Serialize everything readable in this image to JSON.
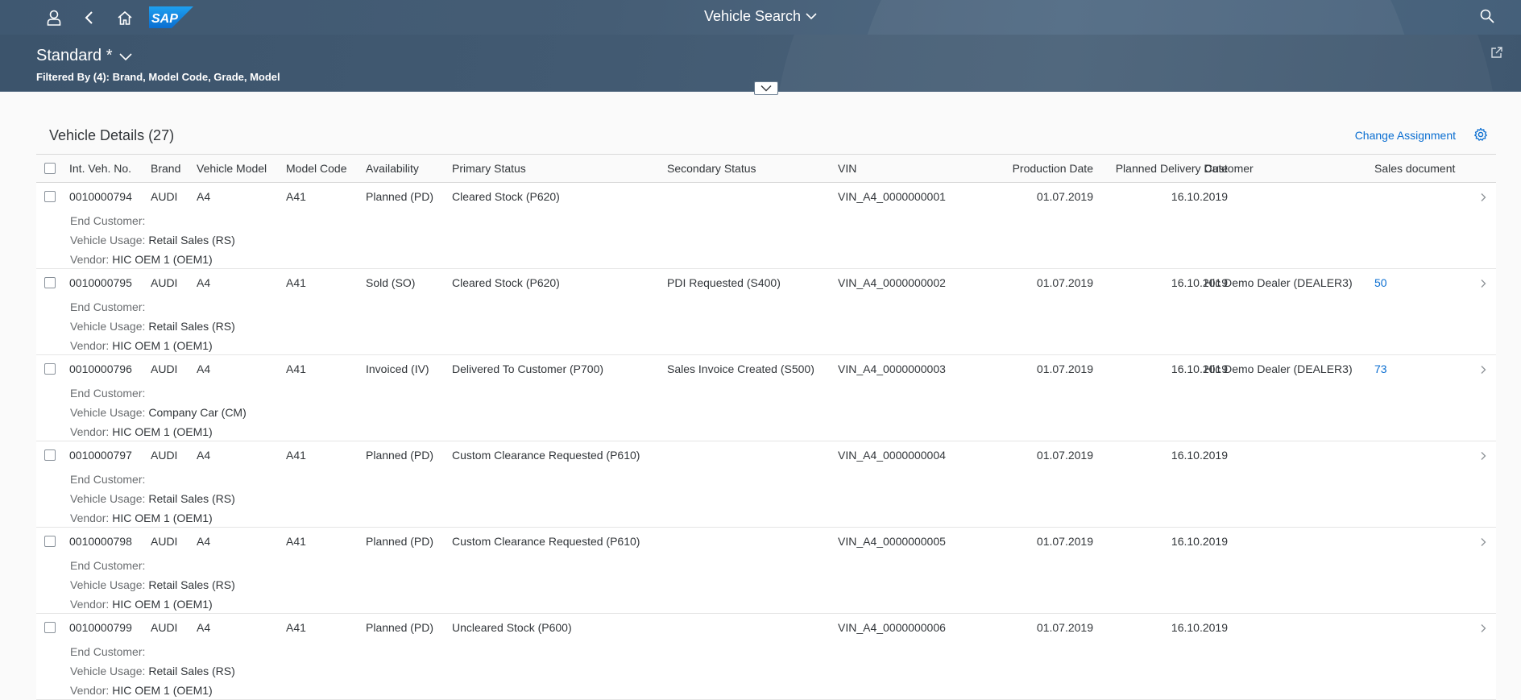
{
  "shell": {
    "title": "Vehicle Search",
    "icons": [
      "user-icon",
      "back-icon",
      "home-icon",
      "sap-logo",
      "search-icon"
    ]
  },
  "header": {
    "variant": "Standard *",
    "filtered_by": "Filtered By (4): Brand, Model Code, Grade, Model"
  },
  "table": {
    "title": "Vehicle Details (27)",
    "change_assignment": "Change Assignment",
    "columns": {
      "int_veh_no": "Int. Veh. No.",
      "brand": "Brand",
      "vehicle_model": "Vehicle Model",
      "model_code": "Model Code",
      "availability": "Availability",
      "primary_status": "Primary Status",
      "secondary_status": "Secondary Status",
      "vin": "VIN",
      "production_date": "Production Date",
      "planned_delivery_date": "Planned Delivery Date",
      "customer": "Customer",
      "sales_document": "Sales document"
    },
    "detail_labels": {
      "end_customer": "End Customer:",
      "vehicle_usage": "Vehicle Usage:",
      "vendor": "Vendor:"
    },
    "rows": [
      {
        "int_veh_no": "0010000794",
        "brand": "AUDI",
        "vehicle_model": "A4",
        "model_code": "A41",
        "availability": "Planned (PD)",
        "primary_status": "Cleared Stock (P620)",
        "secondary_status": "",
        "vin": "VIN_A4_0000000001",
        "production_date": "01.07.2019",
        "planned_delivery_date": "16.10.2019",
        "customer": "",
        "sales_document": "",
        "end_customer": "",
        "vehicle_usage": "Retail Sales (RS)",
        "vendor": "HIC OEM 1 (OEM1)"
      },
      {
        "int_veh_no": "0010000795",
        "brand": "AUDI",
        "vehicle_model": "A4",
        "model_code": "A41",
        "availability": "Sold (SO)",
        "primary_status": "Cleared Stock (P620)",
        "secondary_status": "PDI Requested (S400)",
        "vin": "VIN_A4_0000000002",
        "production_date": "01.07.2019",
        "planned_delivery_date": "16.10.2019",
        "customer": "Hic Demo Dealer (DEALER3)",
        "sales_document": "50",
        "end_customer": "",
        "vehicle_usage": "Retail Sales (RS)",
        "vendor": "HIC OEM 1 (OEM1)"
      },
      {
        "int_veh_no": "0010000796",
        "brand": "AUDI",
        "vehicle_model": "A4",
        "model_code": "A41",
        "availability": "Invoiced (IV)",
        "primary_status": "Delivered To Customer (P700)",
        "secondary_status": "Sales Invoice Created (S500)",
        "vin": "VIN_A4_0000000003",
        "production_date": "01.07.2019",
        "planned_delivery_date": "16.10.2019",
        "customer": "Hic Demo Dealer (DEALER3)",
        "sales_document": "73",
        "end_customer": "",
        "vehicle_usage": "Company Car (CM)",
        "vendor": "HIC OEM 1 (OEM1)"
      },
      {
        "int_veh_no": "0010000797",
        "brand": "AUDI",
        "vehicle_model": "A4",
        "model_code": "A41",
        "availability": "Planned (PD)",
        "primary_status": "Custom Clearance Requested (P610)",
        "secondary_status": "",
        "vin": "VIN_A4_0000000004",
        "production_date": "01.07.2019",
        "planned_delivery_date": "16.10.2019",
        "customer": "",
        "sales_document": "",
        "end_customer": "",
        "vehicle_usage": "Retail Sales (RS)",
        "vendor": "HIC OEM 1 (OEM1)"
      },
      {
        "int_veh_no": "0010000798",
        "brand": "AUDI",
        "vehicle_model": "A4",
        "model_code": "A41",
        "availability": "Planned (PD)",
        "primary_status": "Custom Clearance Requested (P610)",
        "secondary_status": "",
        "vin": "VIN_A4_0000000005",
        "production_date": "01.07.2019",
        "planned_delivery_date": "16.10.2019",
        "customer": "",
        "sales_document": "",
        "end_customer": "",
        "vehicle_usage": "Retail Sales (RS)",
        "vendor": "HIC OEM 1 (OEM1)"
      },
      {
        "int_veh_no": "0010000799",
        "brand": "AUDI",
        "vehicle_model": "A4",
        "model_code": "A41",
        "availability": "Planned (PD)",
        "primary_status": "Uncleared Stock (P600)",
        "secondary_status": "",
        "vin": "VIN_A4_0000000006",
        "production_date": "01.07.2019",
        "planned_delivery_date": "16.10.2019",
        "customer": "",
        "sales_document": "",
        "end_customer": "",
        "vehicle_usage": "Retail Sales (RS)",
        "vendor": "HIC OEM 1 (OEM1)"
      }
    ]
  }
}
